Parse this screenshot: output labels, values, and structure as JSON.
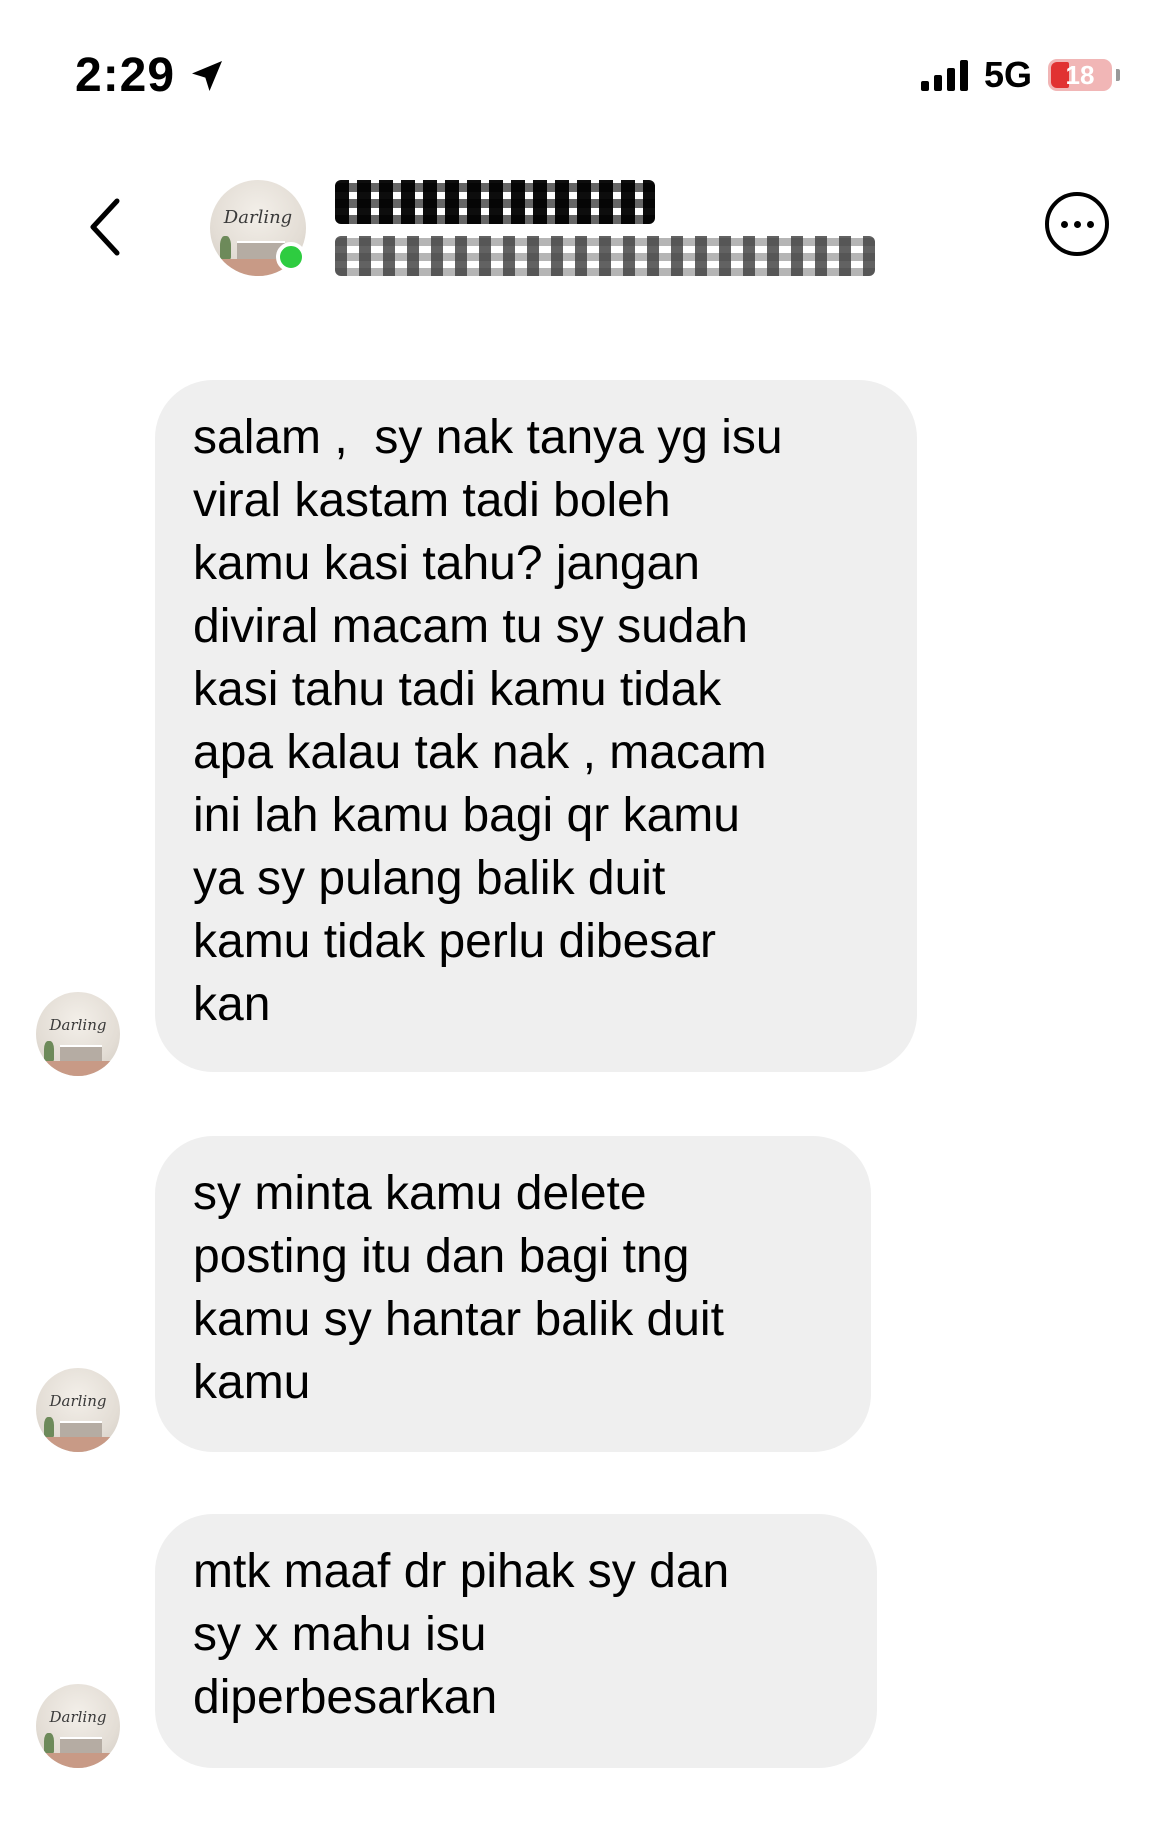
{
  "status_bar": {
    "time": "2:29",
    "network": "5G",
    "battery": "18"
  },
  "header": {
    "contact_name": "",
    "contact_subtitle": "",
    "avatar_text": "Darling"
  },
  "messages": [
    {
      "sender": "contact",
      "text": "salam ,  sy nak tanya yg isu\nviral kastam tadi boleh\nkamu kasi tahu? jangan\ndiviral macam tu sy sudah\nkasi tahu tadi kamu tidak\napa kalau tak nak , macam\nini lah kamu bagi qr kamu\nya sy pulang balik duit\nkamu tidak perlu dibesar\nkan"
    },
    {
      "sender": "contact",
      "text": "sy minta kamu delete\nposting itu dan bagi tng\nkamu sy hantar balik duit\nkamu"
    },
    {
      "sender": "contact",
      "text": "mtk maaf dr pihak sy dan\nsy x mahu isu\ndiperbesarkan"
    }
  ],
  "colors": {
    "bubble_bg": "#efefef",
    "online_dot": "#2ecc40",
    "battery_low": "#e13232"
  }
}
